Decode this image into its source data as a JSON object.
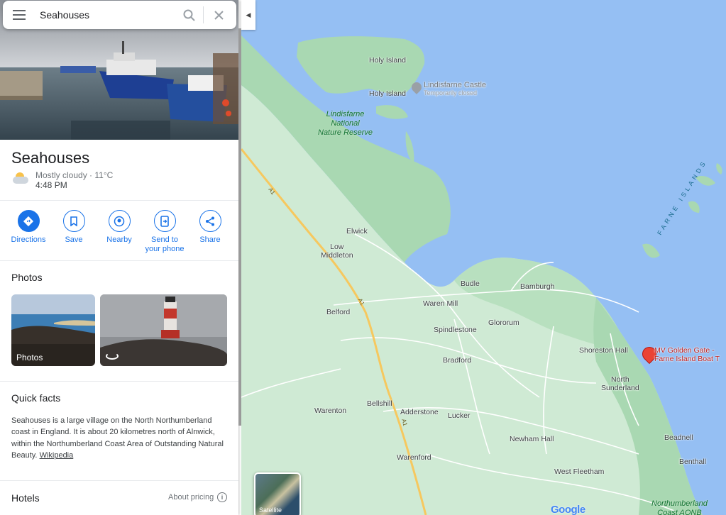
{
  "search": {
    "value": "Seahouses"
  },
  "place": {
    "title": "Seahouses",
    "weather": "Mostly cloudy · 11°C",
    "time": "4:48 PM"
  },
  "actions": [
    {
      "label": "Directions",
      "icon": "directions-icon"
    },
    {
      "label": "Save",
      "icon": "bookmark-icon"
    },
    {
      "label": "Nearby",
      "icon": "nearby-icon"
    },
    {
      "label": "Send to your phone",
      "icon": "send-to-phone-icon"
    },
    {
      "label": "Share",
      "icon": "share-icon"
    }
  ],
  "photos": {
    "heading": "Photos",
    "tile1_label": "Photos"
  },
  "quick_facts": {
    "heading": "Quick facts",
    "text": "Seahouses is a large village on the North Northumberland coast in England. It is about 20 kilometres north of Alnwick, within the Northumberland Coast Area of Outstanding Natural Beauty.",
    "link": "Wikipedia"
  },
  "hotels": {
    "heading": "Hotels",
    "about_pricing": "About pricing"
  },
  "map": {
    "satellite_label": "Satellite",
    "google_logo": "Google",
    "labels": {
      "holy_island_1": "Holy Island",
      "holy_island_2": "Holy Island",
      "lindisfarne_castle": "Lindisfarne Castle",
      "lindisfarne_castle_status": "Temporarily closed",
      "lindisfarne_reserve_1": "Lindisfarne",
      "lindisfarne_reserve_2": "National",
      "lindisfarne_reserve_3": "Nature Reserve",
      "farne_islands": "FARNE ISLANDS",
      "elwick": "Elwick",
      "low_middleton_1": "Low",
      "low_middleton_2": "Middleton",
      "budle": "Budle",
      "bamburgh": "Bamburgh",
      "belford": "Belford",
      "waren_mill": "Waren Mill",
      "glororum": "Glororum",
      "spindlestone": "Spindlestone",
      "shoreston_hall": "Shoreston Hall",
      "mv_golden_gate_1": "MV Golden Gate -",
      "mv_golden_gate_2": "Farne Island Boat T",
      "bradford": "Bradford",
      "north_sunderland_1": "North",
      "north_sunderland_2": "Sunderland",
      "warenton": "Warenton",
      "bellshill": "Bellshill",
      "adderstone": "Adderstone",
      "lucker": "Lucker",
      "newham_hall": "Newham Hall",
      "beadnell": "Beadnell",
      "warenford": "Warenford",
      "benthall": "Benthall",
      "west_fleetham": "West Fleetham",
      "northumberland_coast_1": "Northumberland",
      "northumberland_coast_2": "Coast AONB",
      "a1_1": "A1",
      "a1_2": "A1",
      "a1_3": "A1"
    }
  },
  "colors": {
    "accent": "#1a73e8",
    "land": "#cfead4",
    "water": "#95bff3",
    "road": "#f6c85f"
  }
}
